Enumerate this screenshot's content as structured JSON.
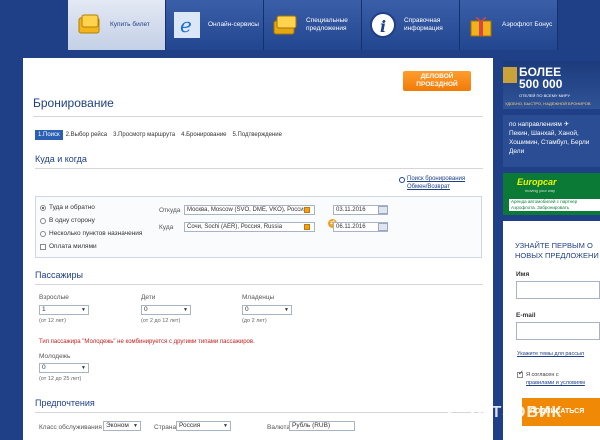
{
  "nav": {
    "tabs": [
      {
        "label": "Купить билет",
        "icon": "ticket-icon",
        "active": true
      },
      {
        "label": "Онлайн-сервисы",
        "icon": "browser-e-icon"
      },
      {
        "label": "Специальные предложения",
        "icon": "tickets-stack-icon"
      },
      {
        "label": "Справочная информация",
        "icon": "info-icon"
      },
      {
        "label": "Аэрофлот Бонус",
        "icon": "gift-icon"
      }
    ]
  },
  "main": {
    "legacy_button": "ДЕЛОВОЙ ПРОЕЗДНОЙ",
    "title": "Бронирование",
    "steps": [
      "1.Поиск",
      "2.Выбор рейса",
      "3.Просмотр маршрута",
      "4.Бронирование",
      "5.Подтверждение"
    ],
    "route_section": {
      "title": "Куда и когда",
      "search_link": "Поиск бронирования Обмен/Возврат",
      "trip_types": [
        "Туда и обратно",
        "В одну сторону",
        "Несколько пунктов назначения"
      ],
      "selected_trip_type": "Туда и обратно",
      "miles_label": "Оплата милями",
      "from_label": "Откуда",
      "from_value": "Москва, Moscow (SVO, DME, VKO), Россия",
      "to_label": "Куда",
      "to_value": "Сочи, Sochi (AER), Россия, Russia",
      "depart_date": "03.11.2016",
      "return_date": "06.11.2016"
    },
    "passengers": {
      "title": "Пассажиры",
      "adults_label": "Взрослые",
      "adults_value": "1",
      "adults_hint": "(от 12 лет)",
      "children_label": "Дети",
      "children_value": "0",
      "children_hint": "(от 2 до 12 лет)",
      "infants_label": "Младенцы",
      "infants_value": "0",
      "infants_hint": "(до 2 лет)",
      "warning": "Тип пассажира \"Молодежь\" не комбинируется с другими типами пассажиров.",
      "youth_label": "Молодежь",
      "youth_value": "0",
      "youth_hint": "(от 12 до 25 лет)"
    },
    "preferences": {
      "title": "Предпочтения",
      "class_label": "Класс обслуживания",
      "class_value": "Эконом",
      "country_label": "Страна",
      "country_value": "Россия",
      "currency_label": "Валюта",
      "currency_value": "Рубль (RUB)"
    }
  },
  "sidebar": {
    "promo_line1": "БОЛЕЕ",
    "promo_line2": "500 000",
    "promo_sub": "ОТЕЛЕЙ ПО ВСЕМУ МИРУ",
    "promo_tagline": "УДОБНО, БЫСТРО, НАДЕЖНОЙ БРОНИРОВ",
    "routes_heading": "по направлениям",
    "routes_list": "Пекин, Шанхай, Ханой, Хошимин, Стамбул, Берли Дели",
    "europcar_logo": "Europcar",
    "europcar_tag": "moving your way",
    "europcar_text": "Аренда автомобилей с партнер Аэрофлота. Забронировать",
    "subscribe_title_1": "УЗНАЙТЕ ПЕРВЫМ О",
    "subscribe_title_2": "НОВЫХ ПРЕДЛОЖЕНИ",
    "name_label": "Имя",
    "email_label": "E-mail",
    "topics_link": "Укажите темы для рассыл",
    "agree_text_1": "Я согласен с",
    "agree_text_2": "правилами и условиям",
    "subscribe_button": "ПОДПИСАТЬСЯ"
  },
  "watermark": "ОТЗОВИК"
}
